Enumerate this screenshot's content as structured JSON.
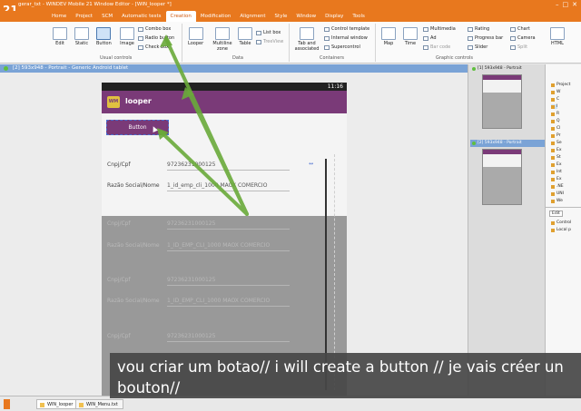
{
  "window": {
    "app_logo": "21",
    "title": "gerar_txt - WINDEV Mobile 21  Window Editor - [WIN_looper *]",
    "controls": [
      "–",
      "□",
      "✕"
    ]
  },
  "menu": {
    "tabs": [
      "Home",
      "Project",
      "SCM",
      "Automatic tests",
      "Creation",
      "Modification",
      "Alignment",
      "Style",
      "Window",
      "Display",
      "Tools"
    ],
    "active": "Creation"
  },
  "ribbon": {
    "buttons": {
      "edit": "Edit",
      "static": "Static",
      "button": "Button",
      "image": "Image",
      "looper": "Looper",
      "multiline": "Multiline zone",
      "table": "Table",
      "tab_associated": "Tab and associated",
      "map": "Map",
      "time": "Time",
      "html": "HTML"
    },
    "small": {
      "combo_box": "Combo box",
      "radio_button": "Radio button",
      "check_box": "Check box",
      "list_box": "List box",
      "treeview": "TreeView",
      "control_template": "Control template",
      "internal_window": "Internal window",
      "supercontrol": "Supercontrol",
      "multimedia": "Multimedia",
      "ad": "Ad",
      "bar_code": "Bar code",
      "rating": "Rating",
      "progress_bar": "Progress bar",
      "slider": "Slider",
      "chart": "Chart",
      "camera": "Camera",
      "split": "Split"
    },
    "groups": {
      "usual": "Usual controls",
      "data": "Data",
      "containers": "Containers",
      "graphic": "Graphic controls"
    }
  },
  "document_tab": "[2] 593x948 - Portrait - Generic Android tablet",
  "phone": {
    "time": "11:16",
    "app_icon": "WM",
    "app_name": "looper",
    "button_label": "Button",
    "fields": [
      {
        "label": "Cnpj/Cpf",
        "value": "97236231000125"
      },
      {
        "label": "Razão Social/Nome",
        "value": "1_id_emp_cli_1000 MAOX COMERCIO"
      }
    ],
    "ghost_rows": [
      {
        "label": "Cnpj/Cpf",
        "value": "97236231000125"
      },
      {
        "label": "Razão Social/Nome",
        "value": "1_ID_EMP_CLI_1000 MAOX COMERCIO"
      },
      {
        "label": "Cnpj/Cpf",
        "value": "97236231000125"
      },
      {
        "label": "Razão Social/Nome",
        "value": "1_ID_EMP_CLI_1000 MAOX COMERCIO"
      },
      {
        "label": "Cnpj/Cpf",
        "value": "97236231000125"
      }
    ]
  },
  "thumbnails": [
    {
      "title": "[1] 593x948 - Portrait"
    },
    {
      "title": "[2] 593x948 - Portrait"
    }
  ],
  "explorer": {
    "items": [
      "Project",
      "W",
      "C",
      "I",
      "R",
      "Q",
      "Cl",
      "Pr",
      "Se",
      "Ex",
      "St",
      "Ex",
      "Int",
      "Ex",
      ".NE",
      "UNI",
      "We",
      "We",
      "XM"
    ],
    "edit_label": "Edit",
    "bottom_items": [
      "Control",
      "Local p"
    ]
  },
  "bottom_tabs": [
    {
      "label": "WIN_looper",
      "active": true
    },
    {
      "label": "WIN_Menu.txt",
      "active": false
    }
  ],
  "caption": "vou criar um botao// i will create a button  // je vais créer un bouton//"
}
